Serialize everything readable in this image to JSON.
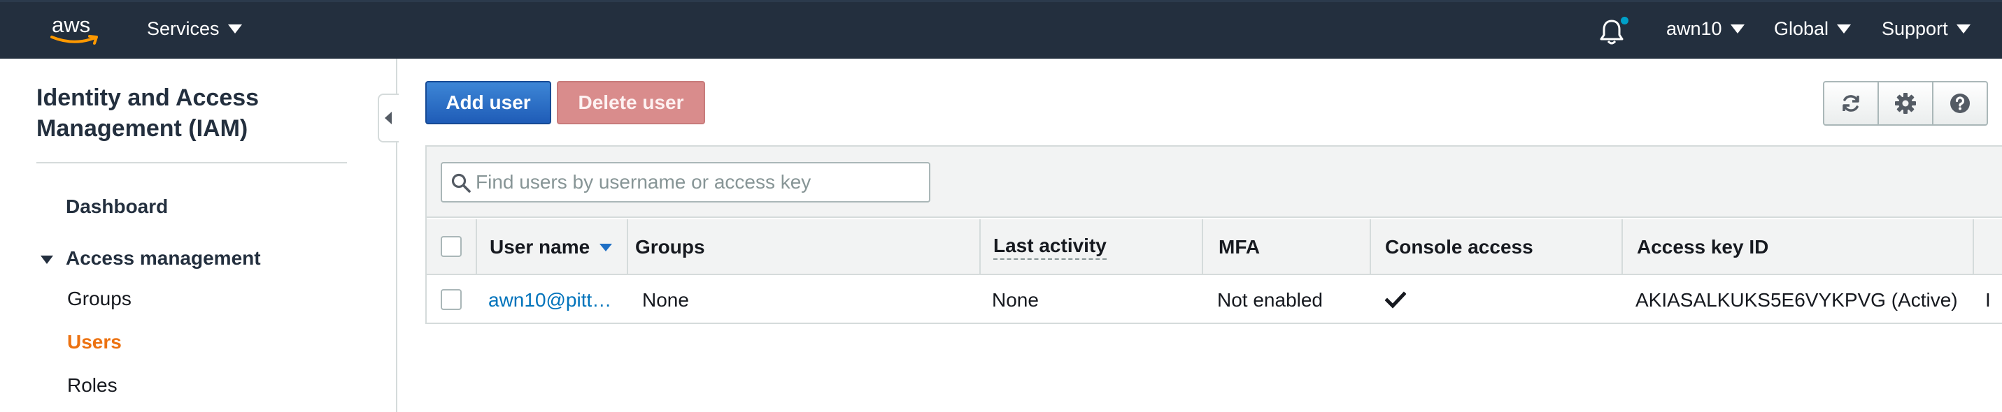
{
  "header": {
    "logo_text": "aws",
    "services_label": "Services",
    "user_label": "awn10",
    "region_label": "Global",
    "support_label": "Support",
    "accent_color": "#00a1c9"
  },
  "sidebar": {
    "title": "Identity and Access Management (IAM)",
    "dashboard_label": "Dashboard",
    "section_label": "Access management",
    "items": [
      {
        "label": "Groups"
      },
      {
        "label": "Users",
        "active": true
      },
      {
        "label": "Roles"
      }
    ],
    "active_color": "#ec7211"
  },
  "toolbar": {
    "add_user_label": "Add user",
    "delete_user_label": "Delete user",
    "icons": [
      "refresh-icon",
      "gear-icon",
      "help-icon"
    ]
  },
  "search": {
    "placeholder": "Find users by username or access key"
  },
  "table": {
    "columns": [
      "User name",
      "Groups",
      "Last activity",
      "MFA",
      "Console access",
      "Access key ID"
    ],
    "rows": [
      {
        "user_name": "awn10@pitt…",
        "groups": "None",
        "last_activity": "None",
        "mfa": "Not enabled",
        "console_access": "check-icon",
        "access_key_id": "AKIASALKUKS5E6VYKPVG (Active)",
        "overflow_text": "I"
      }
    ]
  }
}
